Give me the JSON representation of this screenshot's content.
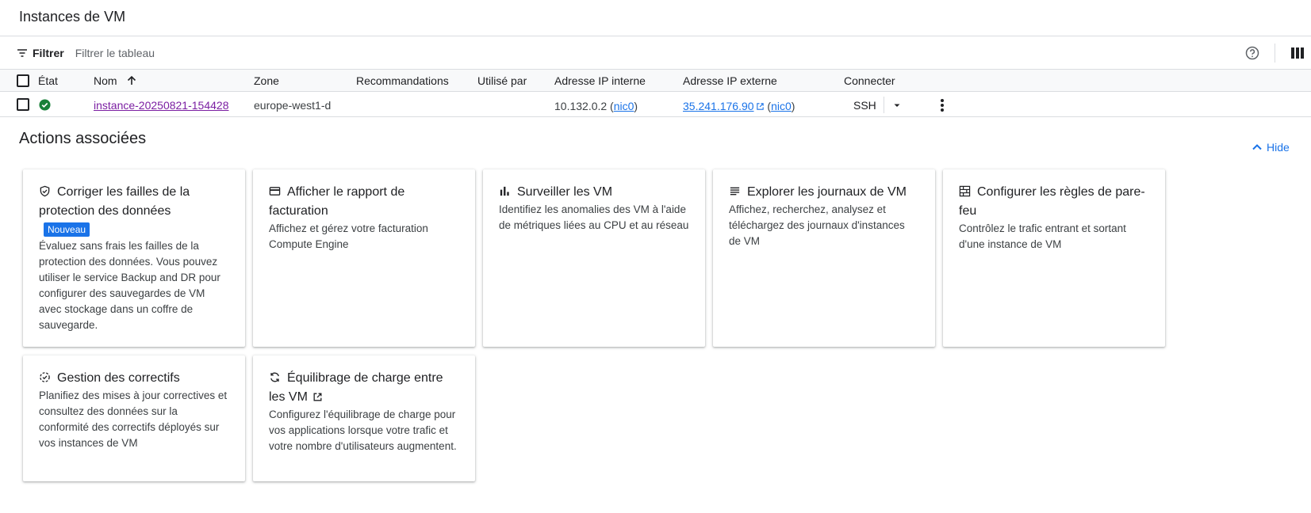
{
  "page": {
    "title": "Instances de VM"
  },
  "filter": {
    "label": "Filtrer",
    "placeholder": "Filtrer le tableau"
  },
  "table": {
    "headers": {
      "status": "État",
      "name": "Nom",
      "zone": "Zone",
      "recommendations": "Recommandations",
      "used_by": "Utilisé par",
      "internal_ip": "Adresse IP interne",
      "external_ip": "Adresse IP externe",
      "connect": "Connecter"
    },
    "rows": [
      {
        "name": "instance-20250821-154428",
        "zone": "europe-west1-d",
        "internal_ip": "10.132.0.2",
        "internal_nic": "nic0",
        "external_ip": "35.241.176.90",
        "external_nic": "nic0",
        "connect": "SSH"
      }
    ]
  },
  "actions": {
    "title": "Actions associées",
    "hide_label": "Hide",
    "cards": [
      {
        "icon": "shield-check-icon",
        "title": "Corriger les failles de la protection des données",
        "badge": "Nouveau",
        "description": "Évaluez sans frais les failles de la protection des données. Vous pouvez utiliser le service Backup and DR pour configurer des sauvegardes de VM avec stockage dans un coffre de sauvegarde."
      },
      {
        "icon": "billing-card-icon",
        "title": "Afficher le rapport de facturation",
        "description": "Affichez et gérez votre facturation Compute Engine"
      },
      {
        "icon": "bar-chart-icon",
        "title": "Surveiller les VM",
        "description": "Identifiez les anomalies des VM à l'aide de métriques liées au CPU et au réseau"
      },
      {
        "icon": "logs-list-icon",
        "title": "Explorer les journaux de VM",
        "description": "Affichez, recherchez, analysez et téléchargez des journaux d'instances de VM"
      },
      {
        "icon": "firewall-icon",
        "title": "Configurer les règles de pare-feu",
        "description": "Contrôlez le trafic entrant et sortant d'une instance de VM"
      },
      {
        "icon": "patch-icon",
        "title": "Gestion des correctifs",
        "description": "Planifiez des mises à jour correctives et consultez des données sur la conformité des correctifs déployés sur vos instances de VM"
      },
      {
        "icon": "load-balancing-icon",
        "title": "Équilibrage de charge entre les VM",
        "description": "Configurez l'équilibrage de charge pour vos applications lorsque votre trafic et votre nombre d'utilisateurs augmentent."
      }
    ]
  },
  "colors": {
    "link": "#1a73e8",
    "visited_link": "#7b1fa2",
    "status_ok": "#188038",
    "badge": "#1a73e8"
  }
}
